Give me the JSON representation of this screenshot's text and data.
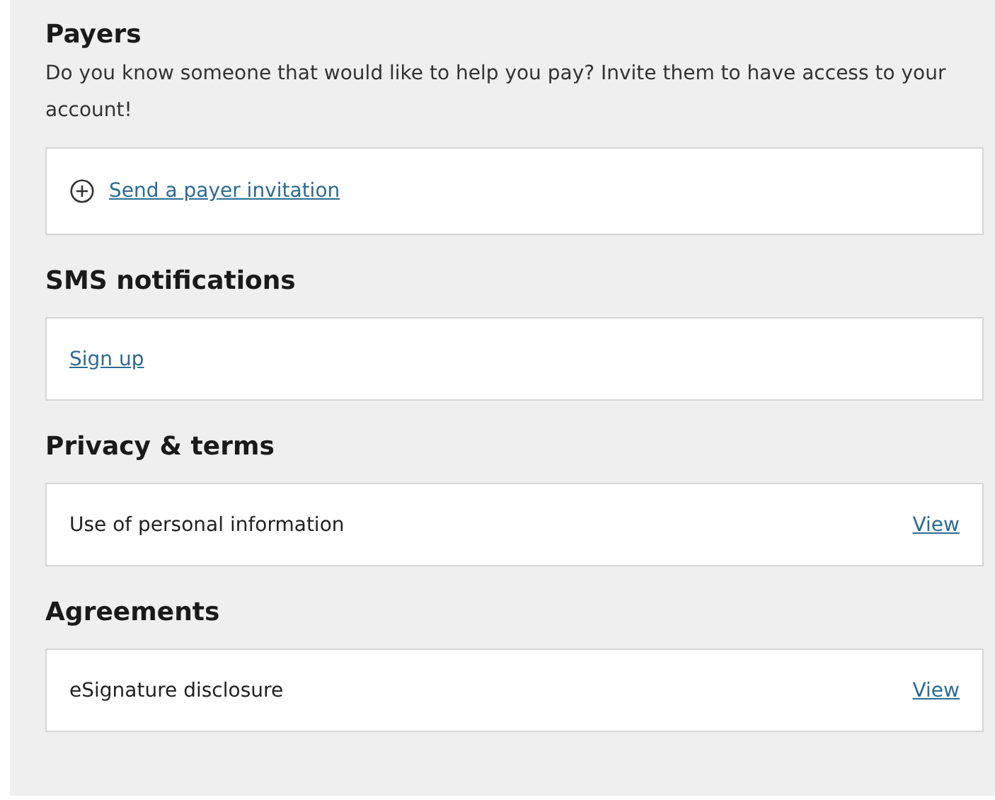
{
  "sections": [
    {
      "title": "Payers",
      "description": "Do you know someone that would like to help you pay? Invite them to have access to your account!",
      "card": {
        "kind": "action",
        "link": "Send a payer invitation"
      }
    },
    {
      "title": "SMS notifications",
      "card": {
        "kind": "link",
        "link": "Sign up"
      }
    },
    {
      "title": "Privacy & terms",
      "card": {
        "kind": "document",
        "label": "Use of personal information",
        "link": "View"
      }
    },
    {
      "title": "Agreements",
      "card": {
        "kind": "document",
        "label": "eSignature disclosure",
        "link": "View"
      }
    }
  ]
}
